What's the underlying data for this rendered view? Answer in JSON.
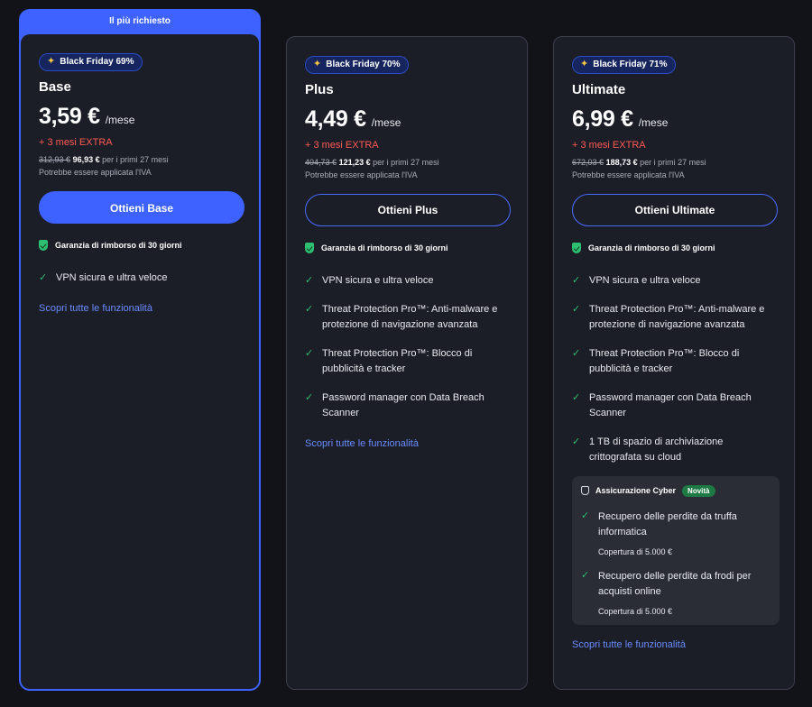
{
  "featured_label": "Il più richiesto",
  "colors": {
    "background": "#121319",
    "card": "#1c1e27",
    "accent": "#3d62ff",
    "extra_red": "#ff5a55",
    "check_green": "#2fbf71",
    "link": "#6a8bff"
  },
  "guarantee_text": "Garanzia di rimborso di 30 giorni",
  "discover_text": "Scopri tutte le funzionalità",
  "plans": [
    {
      "badge": "Black Friday 69%",
      "name": "Base",
      "price": "3,59 €",
      "period": "/mese",
      "extra": "+ 3 mesi EXTRA",
      "old_price": "312,93 €",
      "new_price": "96,93 €",
      "price_note": "per i primi 27 mesi",
      "vat_note": "Potrebbe essere applicata l'IVA",
      "cta": "Ottieni Base",
      "features": [
        "VPN sicura e ultra veloce"
      ]
    },
    {
      "badge": "Black Friday 70%",
      "name": "Plus",
      "price": "4,49 €",
      "period": "/mese",
      "extra": "+ 3 mesi EXTRA",
      "old_price": "404,73 €",
      "new_price": "121,23 €",
      "price_note": "per i primi 27 mesi",
      "vat_note": "Potrebbe essere applicata l'IVA",
      "cta": "Ottieni Plus",
      "features": [
        "VPN sicura e ultra veloce",
        "Threat Protection Pro™: Anti-malware e protezione di navigazione avanzata",
        "Threat Protection Pro™: Blocco di pubblicità e tracker",
        "Password manager con Data Breach Scanner"
      ]
    },
    {
      "badge": "Black Friday 71%",
      "name": "Ultimate",
      "price": "6,99 €",
      "period": "/mese",
      "extra": "+ 3 mesi EXTRA",
      "old_price": "672,03 €",
      "new_price": "188,73 €",
      "price_note": "per i primi 27 mesi",
      "vat_note": "Potrebbe essere applicata l'IVA",
      "cta": "Ottieni Ultimate",
      "features": [
        "VPN sicura e ultra veloce",
        "Threat Protection Pro™: Anti-malware e protezione di navigazione avanzata",
        "Threat Protection Pro™: Blocco di pubblicità e tracker",
        "Password manager con Data Breach Scanner",
        "1 TB di spazio di archiviazione crittografata su cloud"
      ],
      "cyber": {
        "title": "Assicurazione Cyber",
        "badge": "Novità",
        "items": [
          {
            "text": "Recupero delle perdite da truffa informatica",
            "coverage": "Copertura di 5.000 €"
          },
          {
            "text": "Recupero delle perdite da frodi per acquisti online",
            "coverage": "Copertura di 5.000 €"
          }
        ]
      }
    }
  ]
}
